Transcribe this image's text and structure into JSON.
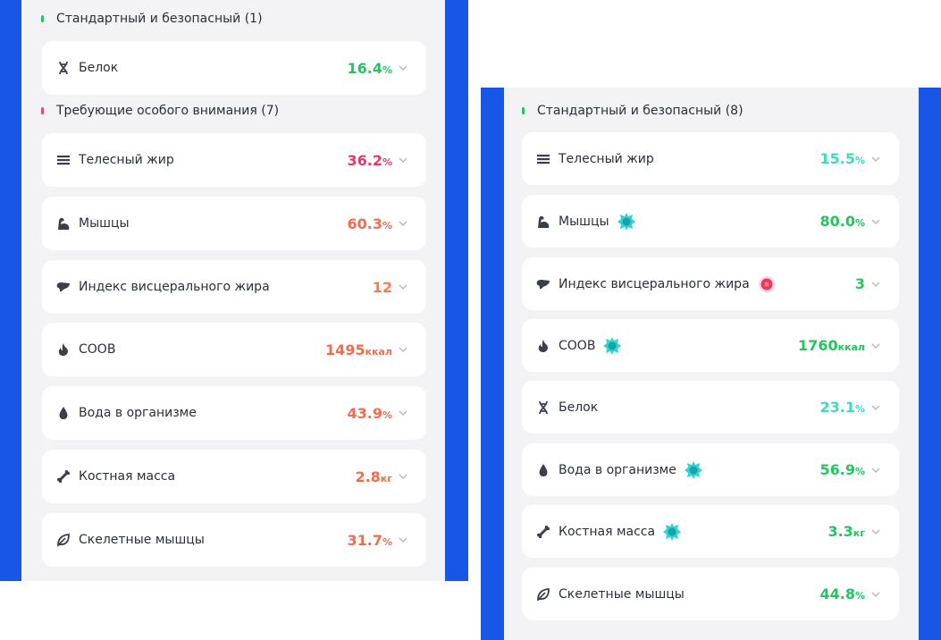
{
  "left": {
    "section_standard": {
      "title": "Стандартный и безопасный (1)",
      "marker_color": "#22c55e"
    },
    "standard_items": [
      {
        "icon": "dna-icon",
        "label": "Белок",
        "value": "16.4",
        "unit": "%",
        "color": "#22c55e"
      }
    ],
    "section_attention": {
      "title": "Требующие особого внимания (7)",
      "marker_color": "#f0446c"
    },
    "attention_items": [
      {
        "icon": "body-fat-icon",
        "label": "Телесный жир",
        "value": "36.2",
        "unit": "%",
        "color": "#f0346a"
      },
      {
        "icon": "muscle-icon",
        "label": "Мышцы",
        "value": "60.3",
        "unit": "%",
        "color": "#f56b4c"
      },
      {
        "icon": "liver-icon",
        "label": "Индекс висцерального жира",
        "value": "12",
        "unit": "",
        "color": "#f77d4f"
      },
      {
        "icon": "flame-icon",
        "label": "СООВ",
        "value": "1495",
        "unit": "ккал",
        "color": "#f56b4c"
      },
      {
        "icon": "water-drop-icon",
        "label": "Вода в организме",
        "value": "43.9",
        "unit": "%",
        "color": "#f56b4c"
      },
      {
        "icon": "bone-icon",
        "label": "Костная масса",
        "value": "2.8",
        "unit": "кг",
        "color": "#f56b4c"
      },
      {
        "icon": "leaf-icon",
        "label": "Скелетные мышцы",
        "value": "31.7",
        "unit": "%",
        "color": "#f56b4c"
      }
    ]
  },
  "right": {
    "section_standard": {
      "title": "Стандартный и безопасный (8)",
      "marker_color": "#22c55e"
    },
    "items": [
      {
        "icon": "body-fat-icon",
        "label": "Телесный жир",
        "value": "15.5",
        "unit": "%",
        "color": "#3fdcb4",
        "badge": ""
      },
      {
        "icon": "muscle-icon",
        "label": "Мышцы",
        "value": "80.0",
        "unit": "%",
        "color": "#22c55e",
        "badge": "achievement-badge-icon"
      },
      {
        "icon": "liver-icon",
        "label": "Индекс висцерального жира",
        "value": "3",
        "unit": "",
        "color": "#22c55e",
        "badge": "alert-dot-icon"
      },
      {
        "icon": "flame-icon",
        "label": "СООВ",
        "value": "1760",
        "unit": "ккал",
        "color": "#22c55e",
        "badge": "achievement-badge-icon"
      },
      {
        "icon": "dna-icon",
        "label": "Белок",
        "value": "23.1",
        "unit": "%",
        "color": "#3fdcb4",
        "badge": ""
      },
      {
        "icon": "water-drop-icon",
        "label": "Вода в организме",
        "value": "56.9",
        "unit": "%",
        "color": "#22c55e",
        "badge": "achievement-badge-icon"
      },
      {
        "icon": "bone-icon",
        "label": "Костная масса",
        "value": "3.3",
        "unit": "кг",
        "color": "#22c55e",
        "badge": "achievement-badge-icon"
      },
      {
        "icon": "leaf-icon",
        "label": "Скелетные мышцы",
        "value": "44.8",
        "unit": "%",
        "color": "#22c55e",
        "badge": ""
      }
    ]
  },
  "colors": {
    "panel_blue": "#1856e8",
    "panel_bg": "#f3f3f6",
    "card_bg": "#ffffff",
    "badge_teal": "#2fd6d0",
    "alert_red": "#f0346a"
  }
}
